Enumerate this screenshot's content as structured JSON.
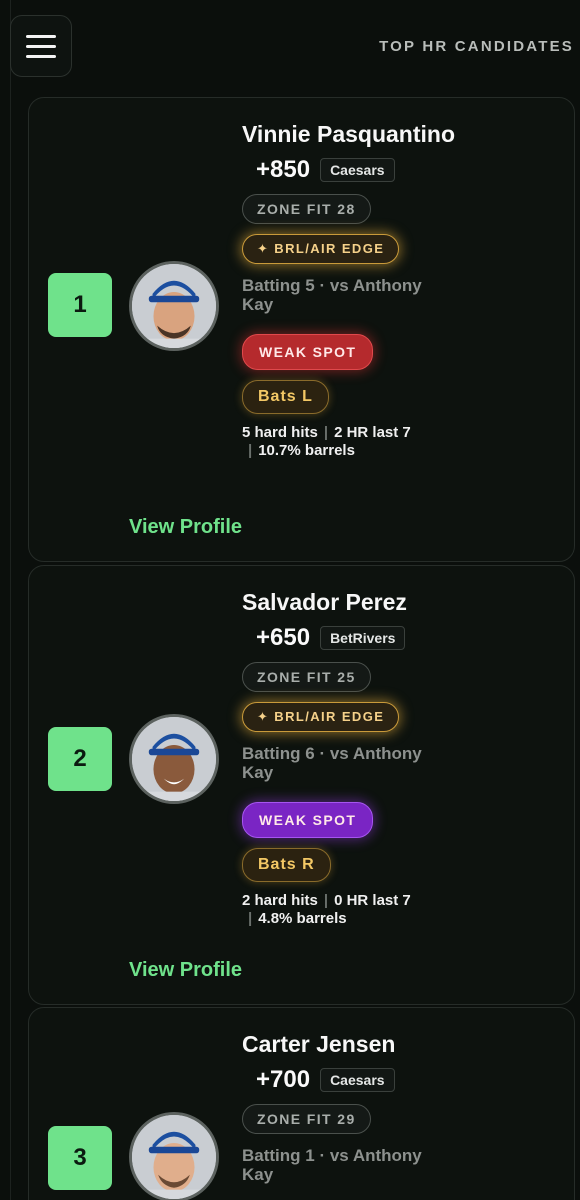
{
  "header": {
    "title": "TOP HR CANDIDATES"
  },
  "icons": {
    "menu": "hamburger-menu-icon"
  },
  "colors": {
    "accent": "#6fe28b",
    "weak_red": "#b52a2d",
    "weak_purple": "#7a25c4",
    "gold": "#f3c865"
  },
  "candidates": [
    {
      "rank": "1",
      "name": "Vinnie Pasquantino",
      "odds": "+850",
      "book": "Caesars",
      "zone_fit": "ZONE FIT 28",
      "edge": "✦ BRL/AIR EDGE",
      "batting": "Batting 5 · vs Anthony Kay",
      "weak_spot": "WEAK SPOT",
      "bats": "Bats L",
      "hard_hits": "5 hard hits",
      "hr_last": "2 HR last 7",
      "barrels": "10.7% barrels",
      "view_profile": "View Profile"
    },
    {
      "rank": "2",
      "name": "Salvador Perez",
      "odds": "+650",
      "book": "BetRivers",
      "zone_fit": "ZONE FIT 25",
      "edge": "✦ BRL/AIR EDGE",
      "batting": "Batting 6 · vs Anthony Kay",
      "weak_spot": "WEAK SPOT",
      "bats": "Bats R",
      "hard_hits": "2 hard hits",
      "hr_last": "0 HR last 7",
      "barrels": "4.8% barrels",
      "view_profile": "View Profile"
    },
    {
      "rank": "3",
      "name": "Carter Jensen",
      "odds": "+700",
      "book": "Caesars",
      "zone_fit": "ZONE FIT 29",
      "batting": "Batting 1 · vs Anthony Kay"
    }
  ]
}
